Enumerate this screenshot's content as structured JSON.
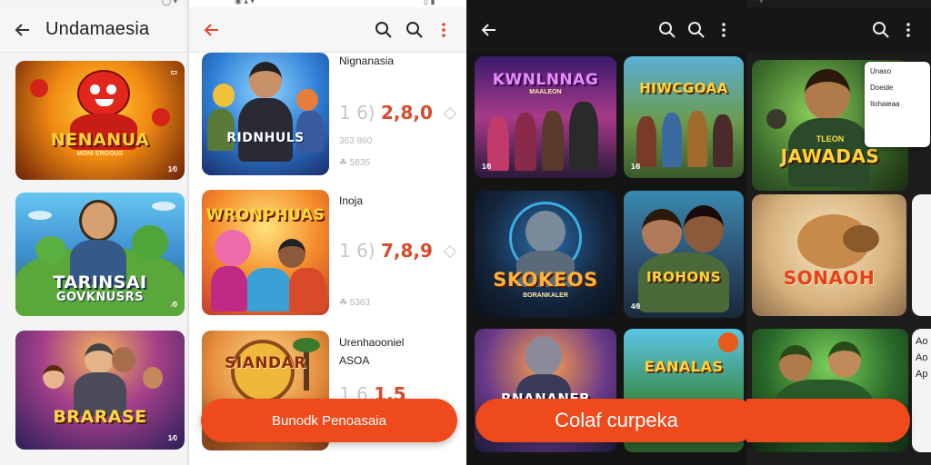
{
  "colors": {
    "accent": "#ee4a1c",
    "price_red": "#d94a2a",
    "dark_bg": "#141414"
  },
  "panel1": {
    "title": "Undamaesia",
    "cards": [
      {
        "logo": "NENANUA",
        "sub": "MONI ERGOUS",
        "badge": "1⁄0"
      },
      {
        "logo": "TARINSAI",
        "logo2": "GOVKNUSRS",
        "badge": "⁄0"
      },
      {
        "logo": "BRARASE",
        "badge": "1⁄0"
      }
    ]
  },
  "panel2": {
    "items": [
      {
        "title": "Nignanasia",
        "card_logo": "RIDNHULS",
        "price_grey": "1 6)",
        "price_red": "2,8,0",
        "sub": "363 860",
        "small": "☘ 5835"
      },
      {
        "title": "Inoja",
        "card_logo": "WRONPHUAS",
        "price_grey": "1 6)",
        "price_red": "7,8,9",
        "small": "☘ 5363"
      },
      {
        "title": "Urenhaooniel",
        "title2": "ASOA",
        "card_logo": "SIANDAR",
        "price_grey": "1 6",
        "price_red": "1,5"
      }
    ],
    "cta": "Bunodk Penoasaia"
  },
  "panel3": {
    "cards": [
      {
        "logo": "KWNLNNAG",
        "sub": "MAALEON",
        "badge": "1⁄8"
      },
      {
        "logo": "HIWCGOAA",
        "badge": "1⁄8"
      },
      {
        "logo": "SKOKEOS",
        "sub": "BORANKALER",
        "badge": ""
      },
      {
        "logo": "IROHONS",
        "badge": "4⁄8"
      },
      {
        "logo": "RNANANEB",
        "badge": ""
      },
      {
        "logo": "EANALAS",
        "badge": ""
      }
    ],
    "cta": "Colaf curpeka"
  },
  "panel4": {
    "cards": [
      {
        "logo": "JAWADAS",
        "sub": "TLEON"
      },
      {
        "logo": "SONAOH"
      },
      {
        "logo": ""
      }
    ],
    "popup": [
      "Unaso",
      "Doeide",
      "Ilohaieaa"
    ],
    "edge_labels": [
      "Ao",
      "Ao",
      "Ap"
    ]
  }
}
